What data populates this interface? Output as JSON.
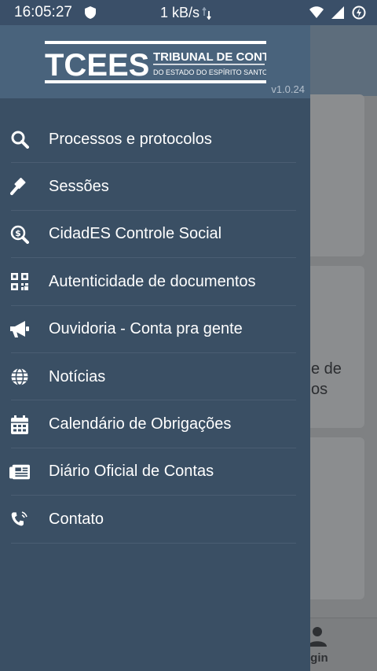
{
  "status_bar": {
    "time": "16:05:27",
    "network_speed": "1 kB/s"
  },
  "drawer": {
    "logo": {
      "mark": "TCEES",
      "line1": "TRIBUNAL DE CONTAS",
      "line2": "DO ESTADO DO ESPÍRITO SANTO"
    },
    "version": "v1.0.24",
    "items": [
      {
        "label": "Processos e protocolos",
        "icon": "search-icon"
      },
      {
        "label": "Sessões",
        "icon": "gavel-icon"
      },
      {
        "label": "CidadES Controle Social",
        "icon": "money-search-icon"
      },
      {
        "label": "Autenticidade de documentos",
        "icon": "qr-code-icon"
      },
      {
        "label": "Ouvidoria - Conta pra gente",
        "icon": "megaphone-icon"
      },
      {
        "label": "Notícias",
        "icon": "globe-icon"
      },
      {
        "label": "Calendário de Obrigações",
        "icon": "calendar-icon"
      },
      {
        "label": "Diário Oficial de Contas",
        "icon": "newspaper-icon"
      },
      {
        "label": "Contato",
        "icon": "phone-icon"
      }
    ]
  },
  "background": {
    "card_text_line1": "e de",
    "card_text_line2": "os",
    "bottom_nav_label": "ogin"
  },
  "colors": {
    "drawer_bg": "#3a4f64",
    "drawer_header_bg": "#49637c",
    "status_bar_bg": "#3a4f68",
    "text": "#ffffff"
  }
}
